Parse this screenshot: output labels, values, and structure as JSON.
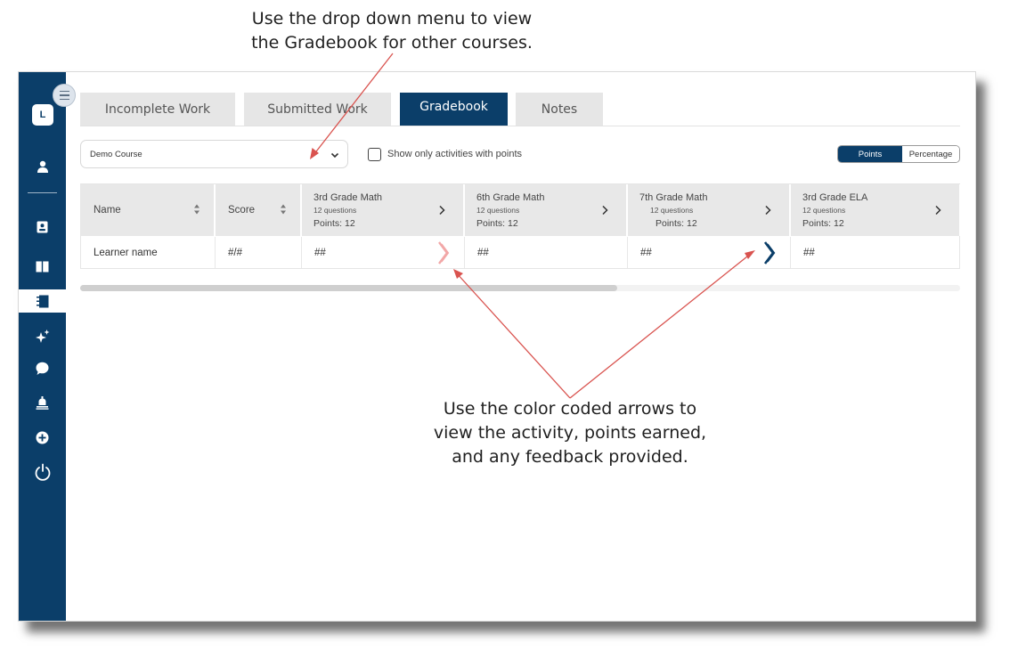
{
  "annotations": {
    "top": [
      "Use the drop down menu to view",
      "the Gradebook for other courses."
    ],
    "bottom": [
      "Use the color coded arrows to",
      "view the activity, points earned,",
      "and any feedback provided."
    ]
  },
  "colors": {
    "brand": "#0b3e69",
    "pointer": "#d9534f",
    "arrow_light": "#f2a7a7",
    "arrow_dark": "#0b3e69"
  },
  "sidebar": {
    "avatar_letter": "L",
    "items": [
      {
        "icon": "person-icon"
      },
      {
        "icon": "contact-card-icon"
      },
      {
        "icon": "open-book-icon"
      },
      {
        "icon": "notebook-icon",
        "active": true
      },
      {
        "icon": "sparkle-icon"
      },
      {
        "icon": "chat-bubble-icon"
      },
      {
        "icon": "bell-icon"
      },
      {
        "icon": "plus-circle-icon"
      },
      {
        "icon": "power-icon"
      }
    ]
  },
  "tabs": [
    {
      "label": "Incomplete Work"
    },
    {
      "label": "Submitted Work"
    },
    {
      "label": "Gradebook",
      "active": true
    },
    {
      "label": "Notes"
    }
  ],
  "filters": {
    "course": "Demo Course",
    "checkbox_label": "Show only activities with points",
    "checkbox_checked": false,
    "toggle": {
      "options": [
        "Points",
        "Percentage"
      ],
      "selected": "Points"
    }
  },
  "gradebook": {
    "col_name": "Name",
    "col_score": "Score",
    "activities": [
      {
        "title": "3rd Grade Math",
        "questions": "12 questions",
        "points": "Points: 12"
      },
      {
        "title": "6th Grade Math",
        "questions": "12 questions",
        "points": "Points: 12"
      },
      {
        "title": "7th Grade Math",
        "questions": "12 questions",
        "points": "Points: 12"
      },
      {
        "title": "3rd Grade ELA",
        "questions": "12 questions",
        "points": "Points: 12"
      }
    ],
    "row": {
      "name": "Learner name",
      "score": "#/#",
      "values": [
        "##",
        "##",
        "##",
        "##"
      ]
    }
  },
  "scrollbar_progress": 0.61
}
